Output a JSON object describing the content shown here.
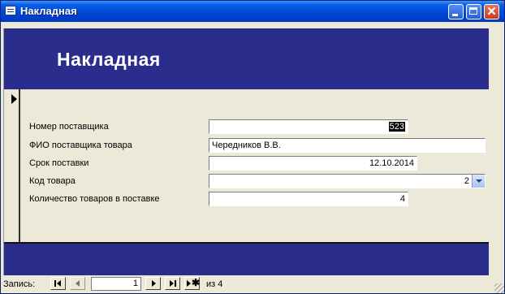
{
  "window": {
    "title": "Накладная"
  },
  "form": {
    "header_title": "Накладная",
    "fields": [
      {
        "label": "Номер поставщика",
        "value": "523"
      },
      {
        "label": "ФИО поставщика товара",
        "value": "Чередников В.В."
      },
      {
        "label": "Срок поставки",
        "value": "12.10.2014"
      },
      {
        "label": "Код товара",
        "value": "2"
      },
      {
        "label": "Количество товаров в поставке",
        "value": "4"
      }
    ]
  },
  "navigation": {
    "record_label": "Запись:",
    "current_record": "1",
    "of_text": "из",
    "total_records": "4"
  }
}
